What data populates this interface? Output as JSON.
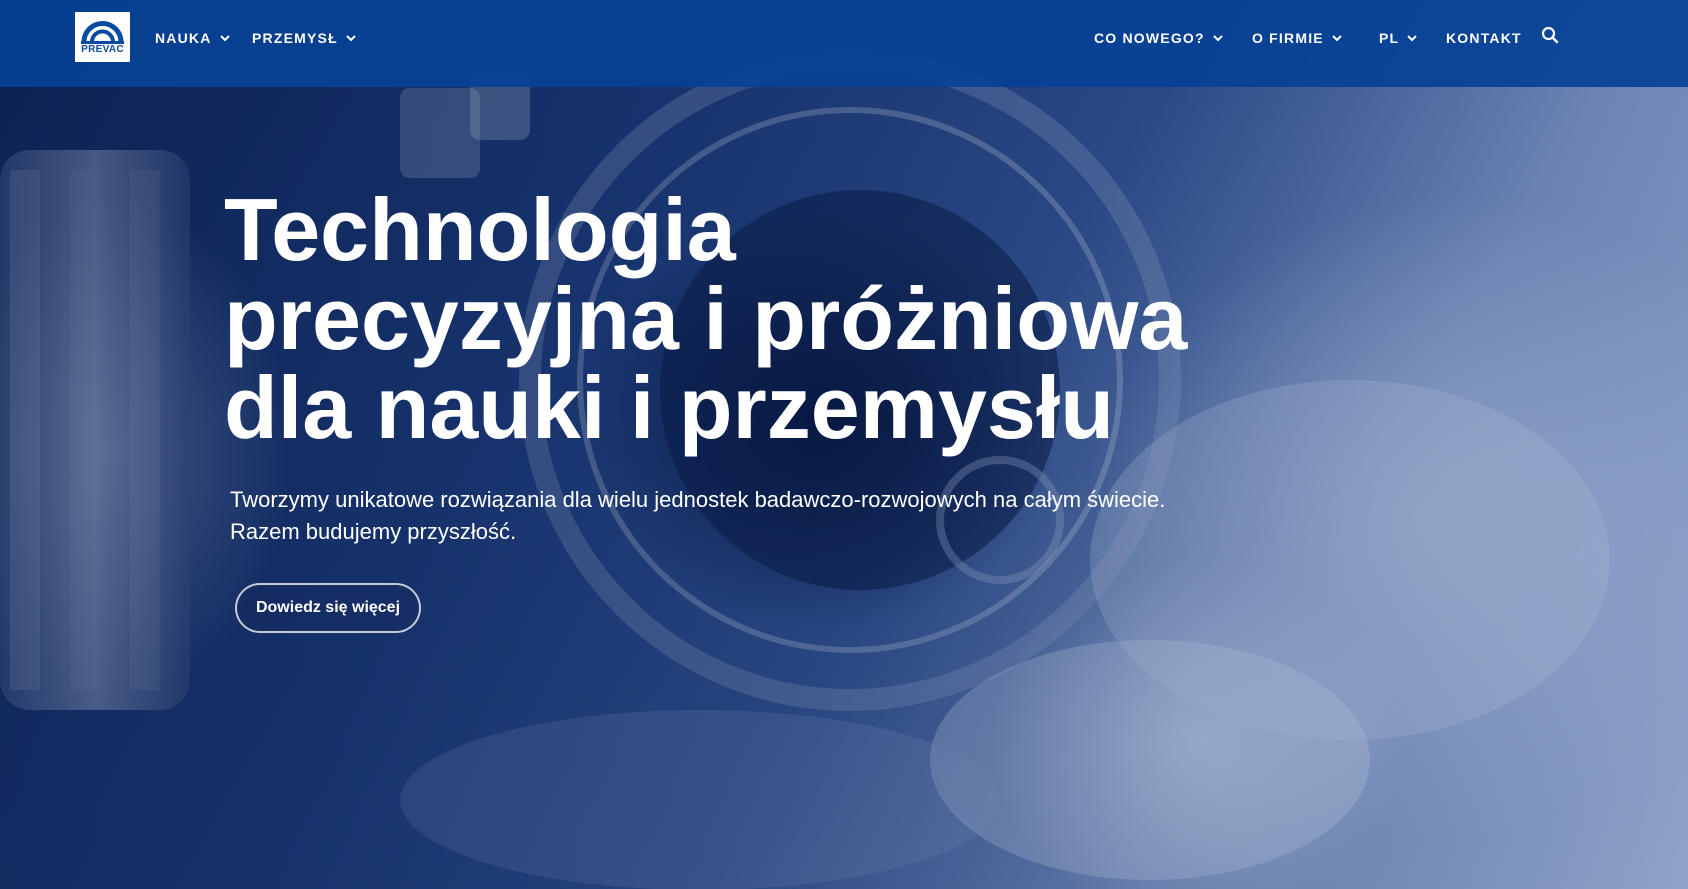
{
  "header": {
    "logo": {
      "text": "PREVAC"
    },
    "nav_left": [
      {
        "label": "NAUKA",
        "has_dropdown": true
      },
      {
        "label": "PRZEMYSŁ",
        "has_dropdown": true
      }
    ],
    "nav_right": [
      {
        "label": "CO NOWEGO?",
        "has_dropdown": true
      },
      {
        "label": "O FIRMIE",
        "has_dropdown": true
      },
      {
        "label": "PL",
        "has_dropdown": true
      },
      {
        "label": "KONTAKT",
        "has_dropdown": false
      }
    ],
    "search_icon": "search-icon"
  },
  "hero": {
    "title_lines": [
      "Technologia",
      "precyzyjna i próżniowa",
      "dla nauki i przemysłu"
    ],
    "subtitle_lines": [
      "Tworzymy unikatowe rozwiązania dla wielu jednostek badawczo-rozwojowych na całym świecie.",
      "Razem budujemy przyszłość."
    ],
    "cta_label": "Dowiedz się więcej"
  },
  "colors": {
    "header_bg": "#0741A0",
    "hero_overlay": "#1C3A78",
    "text": "#FFFFFF"
  }
}
